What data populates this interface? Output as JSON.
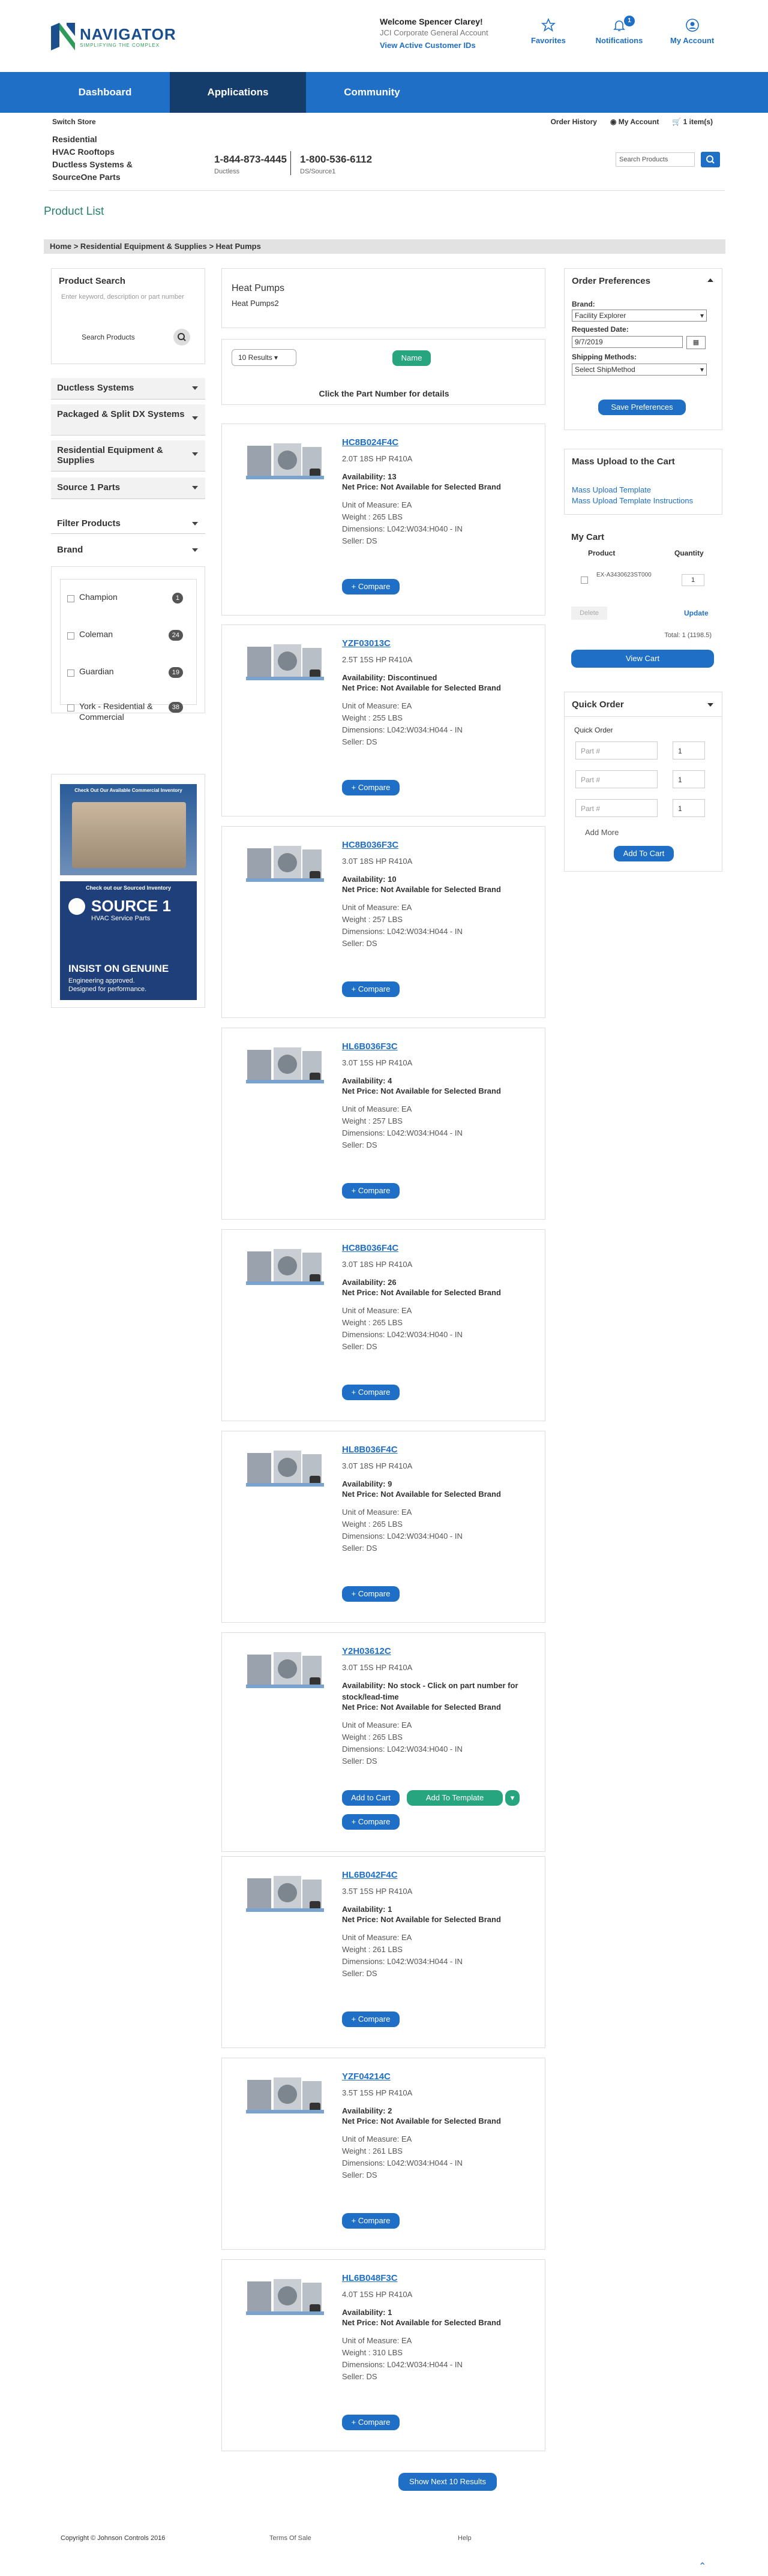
{
  "header": {
    "logo": "NAVIGATOR",
    "tagline": "SIMPLIFYING THE COMPLEX",
    "welcome": "Welcome Spencer Clarey!",
    "company": "JCI Corporate General Account",
    "view_ids": "View Active Customer IDs",
    "favorites": "Favorites",
    "notifications": "Notifications",
    "notif_count": "1",
    "account": "My Account"
  },
  "nav": {
    "dashboard": "Dashboard",
    "applications": "Applications",
    "community": "Community"
  },
  "sub": {
    "switch_store": "Switch Store",
    "order_history": "Order History",
    "my_account": "My Account",
    "cart": "1 item(s)",
    "links": [
      "Residential",
      "HVAC Rooftops",
      "Ductless Systems &",
      "SourceOne Parts"
    ],
    "phone1": "1-844-873-4445",
    "phone1_label": "Ductless",
    "phone2": "1-800-536-6112",
    "phone2_label": "DS/Source1",
    "search_placeholder": "Search Products"
  },
  "page": {
    "title": "Product List",
    "breadcrumb": "Home  >  Residential Equipment & Supplies  >  Heat Pumps"
  },
  "left": {
    "search_title": "Product Search",
    "search_help": "Enter keyword, description or part number",
    "search_placeholder": "Search Products",
    "cats": [
      "Ductless Systems",
      "Packaged & Split DX Systems",
      "Residential Equipment & Supplies",
      "Source 1 Parts"
    ],
    "filter": "Filter Products",
    "brand": "Brand",
    "brands": [
      {
        "name": "Champion",
        "count": "1"
      },
      {
        "name": "Coleman",
        "count": "24"
      },
      {
        "name": "Guardian",
        "count": "19"
      },
      {
        "name": "York - Residential & Commercial",
        "count": "38"
      }
    ],
    "banner1": "Check Out Our Available Commercial Inventory",
    "banner2": "Check out our Sourced Inventory",
    "banner3": "SOURCE 1",
    "banner4": "HVAC Service Parts",
    "banner5": "INSIST ON GENUINE",
    "banner6": "Engineering approved.",
    "banner7": "Designed for performance."
  },
  "main": {
    "heading": "Heat Pumps",
    "sub": "Heat Pumps2",
    "results": "10 Results",
    "sort": "Name",
    "hint": "Click the Part Number for details",
    "show_next": "Show Next 10 Results"
  },
  "products": [
    {
      "pn": "HC8B024F4C",
      "d": "2.0T 18S HP R410A",
      "av": "Availability: 13",
      "np": "Net Price: Not Available for Selected Brand",
      "uom": "Unit of Measure: EA",
      "wt": "Weight : 265 LBS",
      "dim": "Dimensions: L042:W034:H040 - IN",
      "seller": "Seller: DS"
    },
    {
      "pn": "YZF03013C",
      "d": "2.5T 15S HP R410A",
      "av": "Availability: Discontinued",
      "np": "Net Price: Not Available for Selected Brand",
      "uom": "Unit of Measure: EA",
      "wt": "Weight : 255 LBS",
      "dim": "Dimensions: L042:W034:H044 - IN",
      "seller": "Seller: DS"
    },
    {
      "pn": "HC8B036F3C",
      "d": "3.0T 18S HP R410A",
      "av": "Availability: 10",
      "np": "Net Price: Not Available for Selected Brand",
      "uom": "Unit of Measure: EA",
      "wt": "Weight : 257 LBS",
      "dim": "Dimensions: L042:W034:H044 - IN",
      "seller": "Seller: DS"
    },
    {
      "pn": "HL6B036F3C",
      "d": "3.0T 15S HP R410A",
      "av": "Availability: 4",
      "np": "Net Price: Not Available for Selected Brand",
      "uom": "Unit of Measure: EA",
      "wt": "Weight : 257 LBS",
      "dim": "Dimensions: L042:W034:H044 - IN",
      "seller": "Seller: DS"
    },
    {
      "pn": "HC8B036F4C",
      "d": "3.0T 18S HP R410A",
      "av": "Availability: 26",
      "np": "Net Price: Not Available for Selected Brand",
      "uom": "Unit of Measure: EA",
      "wt": "Weight : 265 LBS",
      "dim": "Dimensions: L042:W034:H040 - IN",
      "seller": "Seller: DS"
    },
    {
      "pn": "HL8B036F4C",
      "d": "3.0T 18S HP R410A",
      "av": "Availability: 9",
      "np": "Net Price: Not Available for Selected Brand",
      "uom": "Unit of Measure: EA",
      "wt": "Weight : 265 LBS",
      "dim": "Dimensions: L042:W034:H040 - IN",
      "seller": "Seller: DS"
    },
    {
      "pn": "Y2H03612C",
      "d": "3.0T 15S HP R410A",
      "av": "Availability: No stock - Click on part number for stock/lead-time",
      "np": "Net Price: Not Available for Selected Brand",
      "uom": "Unit of Measure: EA",
      "wt": "Weight : 265 LBS",
      "dim": "Dimensions: L042:W034:H040 - IN",
      "seller": "Seller: DS"
    },
    {
      "pn": "HL6B042F4C",
      "d": "3.5T 15S HP R410A",
      "av": "Availability: 1",
      "np": "Net Price: Not Available for Selected Brand",
      "uom": "Unit of Measure: EA",
      "wt": "Weight : 261 LBS",
      "dim": "Dimensions: L042:W034:H044 - IN",
      "seller": "Seller: DS"
    },
    {
      "pn": "YZF04214C",
      "d": "3.5T 15S HP R410A",
      "av": "Availability: 2",
      "np": "Net Price: Not Available for Selected Brand",
      "uom": "Unit of Measure: EA",
      "wt": "Weight : 261 LBS",
      "dim": "Dimensions: L042:W034:H044 - IN",
      "seller": "Seller: DS"
    },
    {
      "pn": "HL6B048F3C",
      "d": "4.0T 15S HP R410A",
      "av": "Availability: 1",
      "np": "Net Price: Not Available for Selected Brand",
      "uom": "Unit of Measure: EA",
      "wt": "Weight : 310 LBS",
      "dim": "Dimensions: L042:W034:H044 - IN",
      "seller": "Seller: DS"
    }
  ],
  "card_buttons": {
    "compare": "+ Compare",
    "add_cart": "Add to Cart",
    "add_template": "Add To Template"
  },
  "right": {
    "pref_title": "Order Preferences",
    "brand_label": "Brand:",
    "brand_val": "Facility Explorer",
    "date_label": "Requested Date:",
    "date_val": "9/7/2019",
    "ship_label": "Shipping Methods:",
    "ship_val": "Select ShipMethod",
    "save": "Save Preferences",
    "mass_title": "Mass Upload to the Cart",
    "mass1": "Mass Upload Template",
    "mass2": "Mass Upload Template Instructions",
    "cart_title": "My Cart",
    "col_product": "Product",
    "col_qty": "Quantity",
    "cart_item": "EX-A3430623ST000",
    "cart_qty": "1",
    "delete": "Delete",
    "update": "Update",
    "total": "Total: 1 (1198.5)",
    "view_cart": "View Cart",
    "qo_title": "Quick Order",
    "qo_sub": "Quick Order",
    "part_ph": "Part #",
    "qo_qty": "1",
    "add_more": "Add More",
    "add_to_cart": "Add To Cart"
  },
  "footer": {
    "copyright": "Copyright © Johnson Controls 2016",
    "terms": "Terms Of Sale",
    "help": "Help"
  }
}
